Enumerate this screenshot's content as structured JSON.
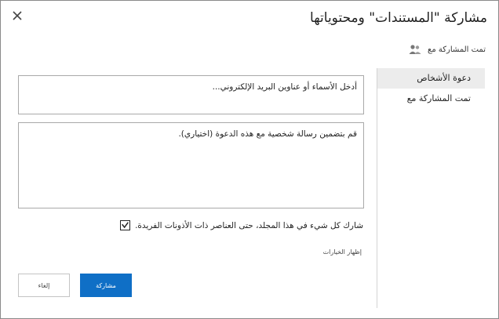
{
  "dialog": {
    "title": "مشاركة \"المستندات\" ومحتوياتها",
    "shared_with_label": "تمت المشاركة مع"
  },
  "nav": {
    "items": [
      {
        "label": "دعوة الأشخاص"
      },
      {
        "label": "تمت المشاركة مع"
      }
    ]
  },
  "form": {
    "names_placeholder": "أدخل الأسماء أو عناوين البريد الإلكتروني...",
    "message_placeholder": "قم بتضمين رسالة شخصية مع هذه الدعوة (اختياري).",
    "share_all_label": "شارك كل شيء في هذا المجلد، حتى العناصر ذات الأذونات الفريدة.",
    "share_all_checked": true,
    "show_options_label": "إظهار الخيارات"
  },
  "buttons": {
    "share_label": "مشاركة",
    "cancel_label": "إلغاء"
  },
  "colors": {
    "accent": "#0f6fc6",
    "nav_active": "#ececec"
  }
}
